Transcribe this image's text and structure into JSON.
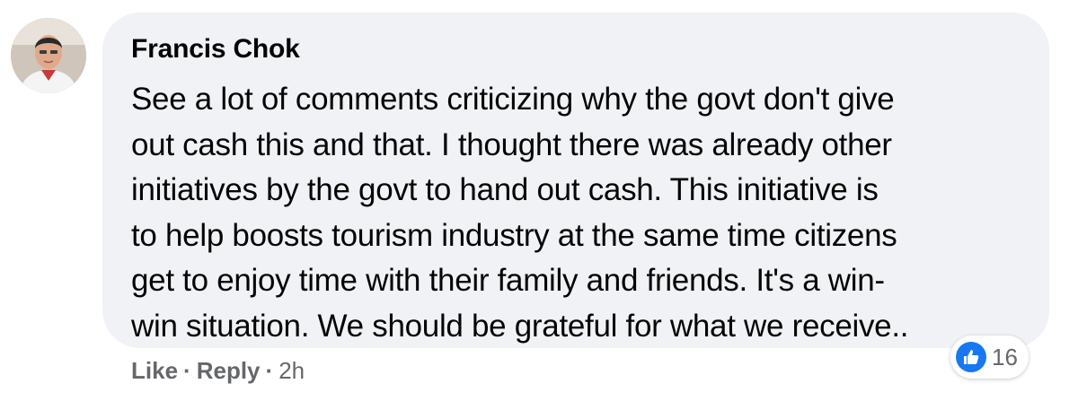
{
  "comment": {
    "author": "Francis Chok",
    "text": "See a lot of comments criticizing why the govt don't give\nout cash this and that. I thought there was already other\ninitiatives by the govt to hand out cash. This initiative is\nto help boosts tourism industry at the same time citizens\nget to enjoy time with their family and friends. It's a win-\nwin situation. We should be grateful for what we receive..",
    "reactions": {
      "icon": "like-icon",
      "count": "16",
      "color": "#1877f2"
    },
    "actions": {
      "like_label": "Like",
      "reply_label": "Reply",
      "separator": "·",
      "timestamp": "2h"
    }
  },
  "colors": {
    "bubble": "#f0f2f5",
    "text": "#050505",
    "secondary": "#65676b"
  }
}
